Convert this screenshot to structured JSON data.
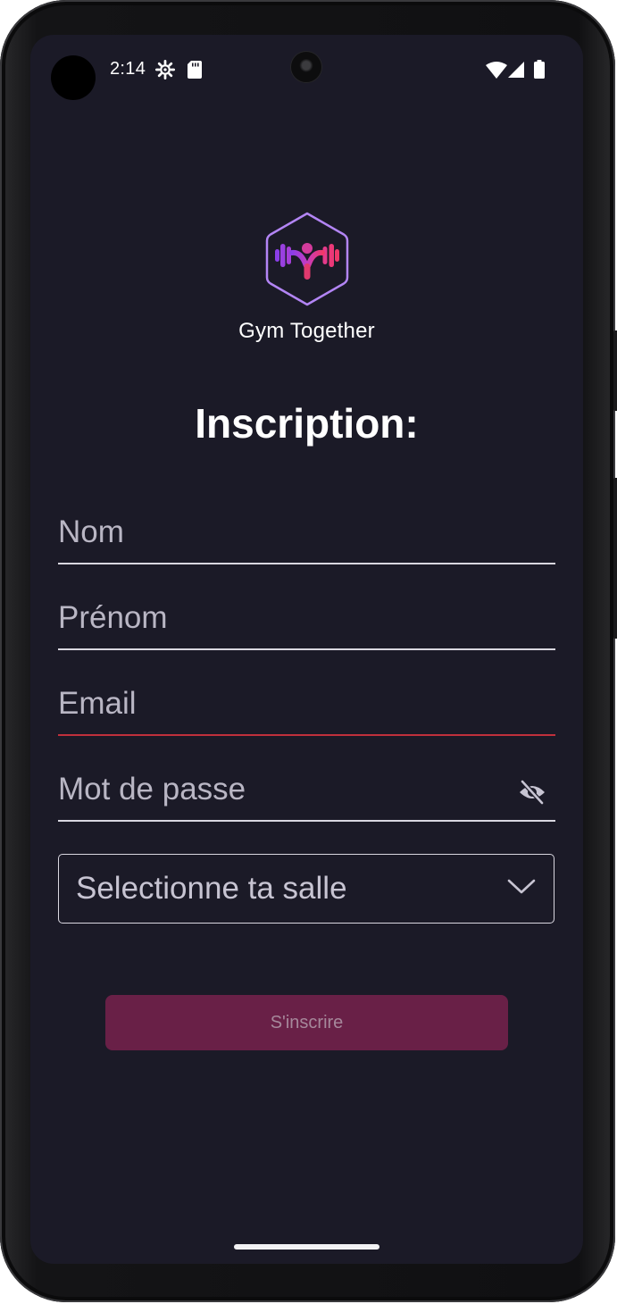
{
  "status_bar": {
    "time": "2:14",
    "icons": [
      "settings-icon",
      "sd-card-icon",
      "wifi-icon",
      "signal-icon",
      "battery-icon"
    ]
  },
  "app": {
    "name": "Gym Together",
    "logo": "gym-together-logo",
    "colors": {
      "background": "#1b1a27",
      "accent": "#692047",
      "logo_gradient_start": "#8a3ee8",
      "logo_gradient_end": "#f0386a"
    }
  },
  "form": {
    "title": "Inscription:",
    "fields": {
      "nom": {
        "placeholder": "Nom",
        "value": ""
      },
      "prenom": {
        "placeholder": "Prénom",
        "value": ""
      },
      "email": {
        "placeholder": "Email",
        "value": "",
        "state": "error"
      },
      "password": {
        "placeholder": "Mot de passe",
        "value": "",
        "toggle_icon": "eye-off-icon"
      }
    },
    "gym_select": {
      "placeholder": "Selectionne ta salle",
      "icon": "chevron-down-icon"
    },
    "submit_label": "S'inscrire"
  }
}
